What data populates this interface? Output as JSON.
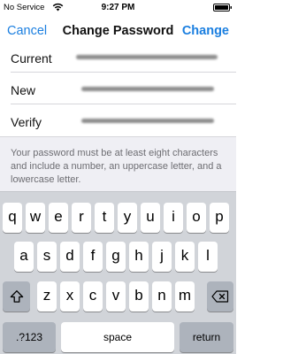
{
  "status_bar": {
    "carrier": "No Service",
    "time": "9:27 PM",
    "wifi_icon": "wifi-icon",
    "battery_icon": "battery-icon"
  },
  "nav": {
    "cancel_label": "Cancel",
    "title": "Change Password",
    "change_label": "Change",
    "accent_color": "#1b7fe0"
  },
  "form": {
    "rows": [
      {
        "label": "Current",
        "value_hidden": true
      },
      {
        "label": "New",
        "value_hidden": true
      },
      {
        "label": "Verify",
        "value_hidden": true
      }
    ]
  },
  "help": {
    "text": "Your password must be at least eight characters and include a number, an uppercase letter, and a lowercase letter."
  },
  "keyboard": {
    "row1": [
      "q",
      "w",
      "e",
      "r",
      "t",
      "y",
      "u",
      "i",
      "o",
      "p"
    ],
    "row2": [
      "a",
      "s",
      "d",
      "f",
      "g",
      "h",
      "j",
      "k",
      "l"
    ],
    "row3": [
      "z",
      "x",
      "c",
      "v",
      "b",
      "n",
      "m"
    ],
    "shift_icon": "shift-icon",
    "delete_icon": "backspace-icon",
    "numbers_label": ".?123",
    "space_label": "space",
    "return_label": "return"
  }
}
